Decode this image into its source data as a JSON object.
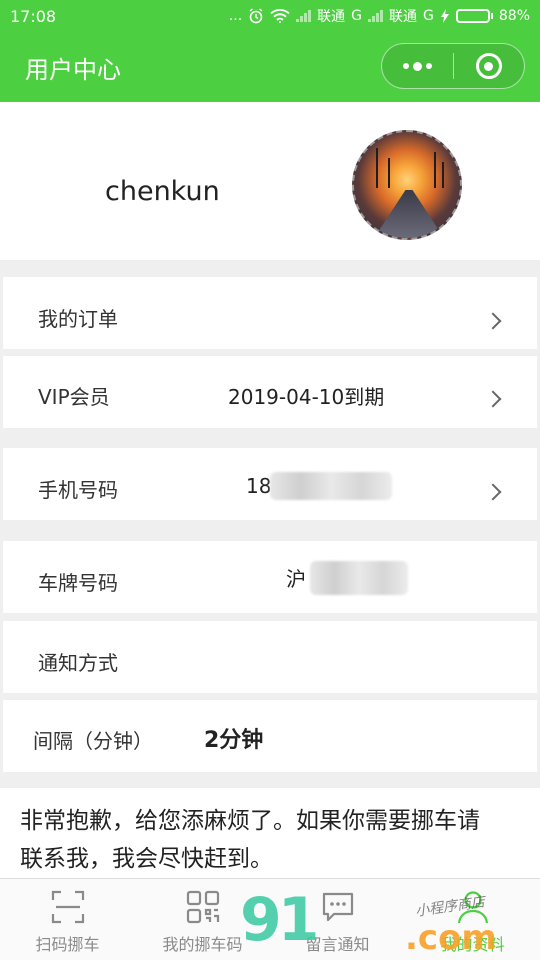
{
  "status_bar": {
    "time": "17:08",
    "dots": "...",
    "carrier1": "联通",
    "net1": "G",
    "carrier2": "联通",
    "net2": "G",
    "battery_percent": "88%",
    "battery_level": 0.88
  },
  "nav": {
    "title": "用户中心"
  },
  "profile": {
    "username": "chenkun"
  },
  "rows": {
    "orders": {
      "label": "我的订单"
    },
    "vip": {
      "label": "VIP会员",
      "value": "2019-04-10到期"
    },
    "phone": {
      "label": "手机号码",
      "value": "18"
    },
    "plate": {
      "label": "车牌号码",
      "value": "沪"
    },
    "notify": {
      "label": "通知方式"
    },
    "interval": {
      "label": "间隔（分钟）",
      "value": "2分钟"
    }
  },
  "notice": {
    "text": "非常抱歉，给您添麻烦了。如果你需要挪车请联系我，我会尽快赶到。"
  },
  "tabbar": {
    "items": [
      {
        "label": "扫码挪车",
        "icon": "scan-icon"
      },
      {
        "label": "我的挪车码",
        "icon": "qrcode-icon"
      },
      {
        "label": "留言通知",
        "icon": "message-icon"
      },
      {
        "label": "我的资料",
        "icon": "user-icon"
      }
    ],
    "active_index": 3
  },
  "watermark": {
    "main": "91",
    "suffix": ".com",
    "tag": "小程序商店"
  },
  "colors": {
    "brand_green": "#4dcf42",
    "watermark_teal": "#37c8a0",
    "watermark_orange": "#f6a028"
  }
}
